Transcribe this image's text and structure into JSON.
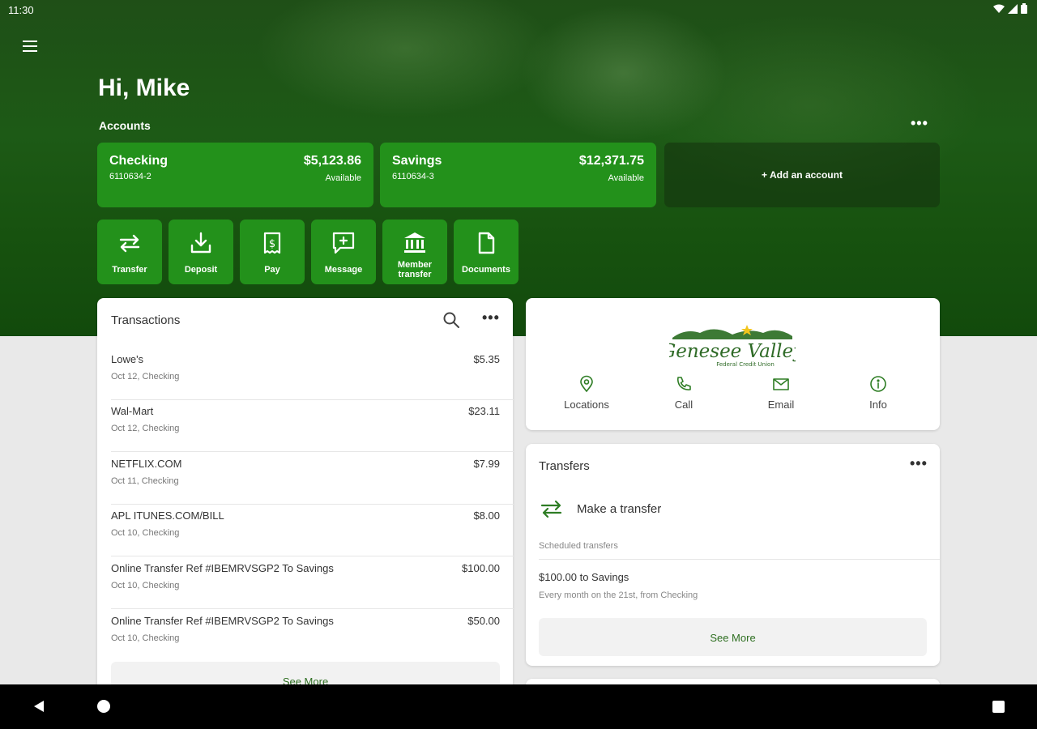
{
  "status_bar": {
    "time": "11:30",
    "icons": [
      "wifi-icon",
      "signal-icon",
      "battery-icon"
    ]
  },
  "colors": {
    "brand_green": "#23911b",
    "hero_green": "#1d5a16",
    "link_green": "#2e6f21"
  },
  "header": {
    "greeting": "Hi, Mike",
    "accounts_label": "Accounts",
    "more": "•••"
  },
  "accounts": [
    {
      "name": "Checking",
      "number": "6110634-2",
      "balance": "$5,123.86",
      "balance_label": "Available"
    },
    {
      "name": "Savings",
      "number": "6110634-3",
      "balance": "$12,371.75",
      "balance_label": "Available"
    }
  ],
  "add_account": "+ Add an account",
  "quick_actions": [
    {
      "label": "Transfer",
      "icon": "transfer-icon"
    },
    {
      "label": "Deposit",
      "icon": "deposit-icon"
    },
    {
      "label": "Pay",
      "icon": "pay-icon"
    },
    {
      "label": "Message",
      "icon": "message-icon"
    },
    {
      "label": "Member transfer",
      "icon": "bank-icon"
    },
    {
      "label": "Documents",
      "icon": "document-icon"
    }
  ],
  "transactions": {
    "title": "Transactions",
    "more": "•••",
    "items": [
      {
        "description": "Lowe's",
        "meta": "Oct 12, Checking",
        "amount": "$5.35"
      },
      {
        "description": "Wal-Mart",
        "meta": "Oct 12, Checking",
        "amount": "$23.11"
      },
      {
        "description": "NETFLIX.COM",
        "meta": "Oct 11, Checking",
        "amount": "$7.99"
      },
      {
        "description": "APL ITUNES.COM/BILL",
        "meta": "Oct 10, Checking",
        "amount": "$8.00"
      },
      {
        "description": "Online Transfer Ref #IBEMRVSGP2 To Savings",
        "meta": "Oct 10, Checking",
        "amount": "$100.00"
      },
      {
        "description": "Online Transfer Ref #IBEMRVSGP2 To Savings",
        "meta": "Oct 10, Checking",
        "amount": "$50.00"
      }
    ],
    "see_more": "See More"
  },
  "brand": {
    "logo_text": "Genesee Valley",
    "logo_subtext": "Federal Credit Union",
    "actions": [
      {
        "label": "Locations",
        "icon": "location-pin-icon"
      },
      {
        "label": "Call",
        "icon": "phone-icon"
      },
      {
        "label": "Email",
        "icon": "email-icon"
      },
      {
        "label": "Info",
        "icon": "info-icon"
      }
    ]
  },
  "transfers": {
    "title": "Transfers",
    "more": "•••",
    "make_transfer": "Make a transfer",
    "scheduled_label": "Scheduled transfers",
    "scheduled": [
      {
        "title": "$100.00 to Savings",
        "subtitle": "Every month on the 21st, from Checking"
      }
    ],
    "see_more": "See More"
  }
}
